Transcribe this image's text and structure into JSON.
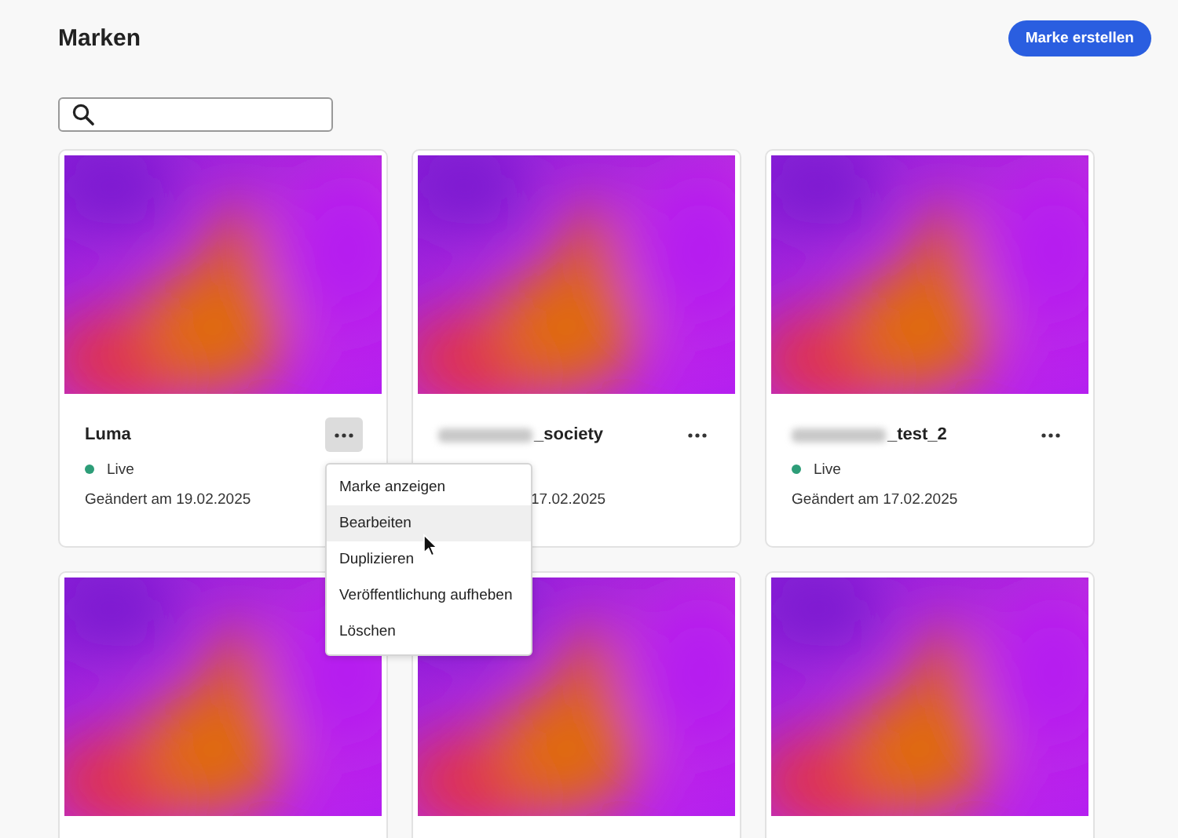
{
  "header": {
    "title": "Marken",
    "create_button": "Marke erstellen"
  },
  "cards": [
    {
      "kind": "brand",
      "name": "Luma",
      "name_redacted": false,
      "status": "Live",
      "date": "Geändert am 19.02.2025",
      "menu_open": true
    },
    {
      "kind": "brand",
      "name": "_society",
      "name_redacted": true,
      "date": "17.02.2025",
      "menu_open": false
    },
    {
      "kind": "brand",
      "name": "_test_2",
      "name_redacted": true,
      "status": "Live",
      "date": "Geändert am 17.02.2025",
      "menu_open": false
    },
    {
      "kind": "image_only"
    },
    {
      "kind": "image_only"
    },
    {
      "kind": "image_only"
    }
  ],
  "menu": {
    "items": [
      {
        "label": "Marke anzeigen",
        "highlighted": false
      },
      {
        "label": "Bearbeiten",
        "highlighted": true
      },
      {
        "label": "Duplizieren",
        "highlighted": false
      },
      {
        "label": "Veröffentlichung aufheben",
        "highlighted": false
      },
      {
        "label": "Löschen",
        "highlighted": false
      }
    ]
  }
}
